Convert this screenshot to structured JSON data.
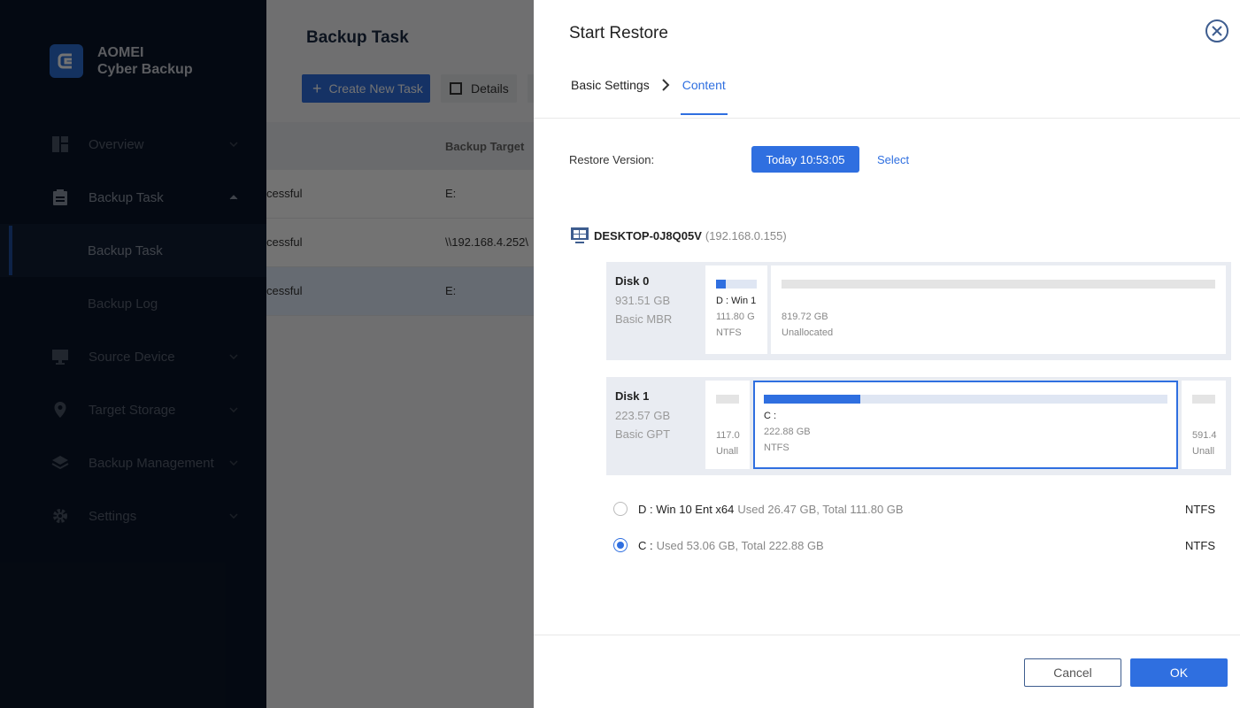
{
  "sidebar": {
    "brand_line1": "AOMEI",
    "brand_line2": "Cyber Backup",
    "items": [
      {
        "label": "Overview",
        "icon": "dashboard-icon"
      },
      {
        "label": "Backup Task",
        "icon": "clipboard-icon"
      },
      {
        "label": "Source Device",
        "icon": "monitor-icon"
      },
      {
        "label": "Target Storage",
        "icon": "location-icon"
      },
      {
        "label": "Backup Management",
        "icon": "layers-icon"
      },
      {
        "label": "Settings",
        "icon": "gear-icon"
      }
    ],
    "subitems": [
      {
        "label": "Backup Task",
        "active": true
      },
      {
        "label": "Backup Log",
        "active": false
      }
    ]
  },
  "main": {
    "title": "Backup Task",
    "create_label": "Create New Task",
    "details_label": "Details",
    "column_target": "Backup Target",
    "rows": [
      {
        "status": "cessful",
        "target": "E:"
      },
      {
        "status": "cessful",
        "target": "\\\\192.168.4.252\\"
      },
      {
        "status": "cessful",
        "target": "E:"
      }
    ]
  },
  "drawer": {
    "title": "Start Restore",
    "steps": [
      "Basic Settings",
      "Content"
    ],
    "restore_version_label": "Restore Version:",
    "restore_version_value": "Today 10:53:05",
    "select_label": "Select",
    "device_name": "DESKTOP-0J8Q05V",
    "device_ip": "(192.168.0.155)",
    "disks": [
      {
        "name": "Disk 0",
        "size": "931.51 GB",
        "type": "Basic MBR",
        "partitions": [
          {
            "label": "D : Win 1",
            "size": "111.80 G",
            "fs": "NTFS",
            "used": 0.24
          },
          {
            "label": "",
            "size": "819.72 GB",
            "fs": "Unallocated",
            "used": 0
          }
        ]
      },
      {
        "name": "Disk 1",
        "size": "223.57 GB",
        "type": "Basic GPT",
        "partitions": [
          {
            "label": "",
            "size": "117.0",
            "fs": "Unall",
            "used": 0
          },
          {
            "label": "C :",
            "size": "222.88 GB",
            "fs": "NTFS",
            "used": 0.24
          },
          {
            "label": "",
            "size": "591.4",
            "fs": "Unall",
            "used": 0
          }
        ]
      }
    ],
    "volumes": [
      {
        "name": "D : Win 10 Ent x64",
        "detail": "Used 26.47 GB, Total 111.80 GB",
        "fs": "NTFS",
        "checked": false
      },
      {
        "name": "C :",
        "detail": "Used 53.06 GB, Total 222.88 GB",
        "fs": "NTFS",
        "checked": true
      }
    ],
    "cancel_label": "Cancel",
    "ok_label": "OK"
  },
  "colors": {
    "accent": "#2f6fe0",
    "sidebar_bg": "#0b1628"
  }
}
